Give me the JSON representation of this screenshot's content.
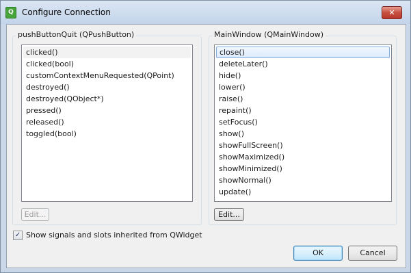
{
  "window": {
    "title": "Configure Connection",
    "app_icon": "qt-designer-icon",
    "close_glyph": "✕"
  },
  "sender": {
    "group_title": "pushButtonQuit (QPushButton)",
    "signals": [
      "clicked()",
      "clicked(bool)",
      "customContextMenuRequested(QPoint)",
      "destroyed()",
      "destroyed(QObject*)",
      "pressed()",
      "released()",
      "toggled(bool)"
    ],
    "selected_index": 0,
    "edit_label": "Edit...",
    "edit_enabled": false
  },
  "receiver": {
    "group_title": "MainWindow (QMainWindow)",
    "slots": [
      "close()",
      "deleteLater()",
      "hide()",
      "lower()",
      "raise()",
      "repaint()",
      "setFocus()",
      "show()",
      "showFullScreen()",
      "showMaximized()",
      "showMinimized()",
      "showNormal()",
      "update()"
    ],
    "selected_index": 0,
    "edit_label": "Edit...",
    "edit_enabled": true
  },
  "options": {
    "show_inherited_label": "Show signals and slots inherited from QWidget",
    "show_inherited_checked": true,
    "check_glyph": "✓"
  },
  "buttons": {
    "ok_label": "OK",
    "cancel_label": "Cancel"
  },
  "colors": {
    "selection_border": "#84acdd",
    "close_button": "#c75040",
    "default_button_border": "#3c7fb1"
  }
}
